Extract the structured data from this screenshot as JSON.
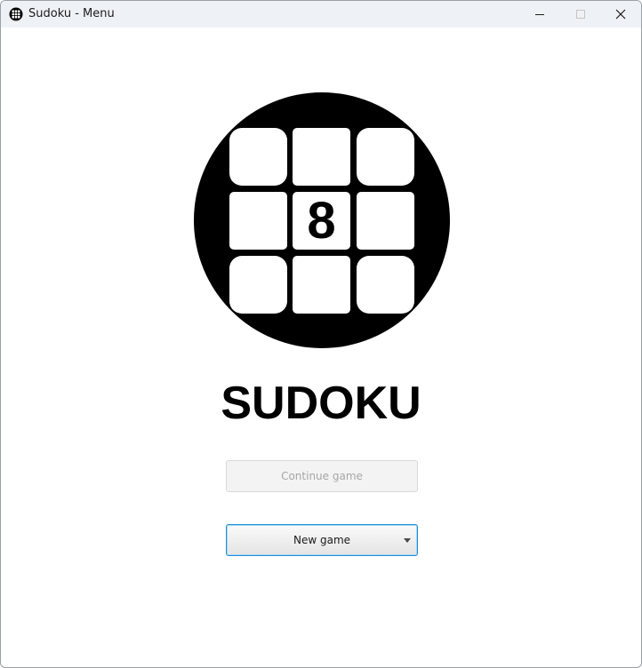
{
  "window": {
    "title": "Sudoku - Menu",
    "app_icon": "sudoku-grid-icon",
    "controls": {
      "minimize_icon": "minimize-icon",
      "maximize_icon": "maximize-icon",
      "close_icon": "close-icon"
    }
  },
  "logo": {
    "icon": "sudoku-logo-icon",
    "center_digit": "8"
  },
  "main": {
    "game_title": "SUDOKU",
    "continue_label": "Continue game",
    "continue_enabled": false,
    "new_game_label": "New game",
    "new_game_dropdown_icon": "caret-down-icon"
  },
  "colors": {
    "titlebar": "#eef2f6",
    "focus_border": "#1e90d6",
    "logo": "#000000"
  }
}
